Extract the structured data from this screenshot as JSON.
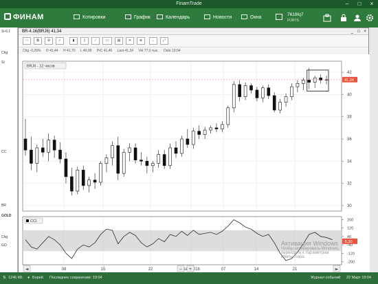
{
  "app": {
    "window_title": "FinamTrade",
    "logo": "ФИНАМ"
  },
  "menu": [
    {
      "label": "Котировки",
      "icon": "quotes-icon"
    },
    {
      "label": "График",
      "icon": "chart-icon"
    },
    {
      "label": "Календарь",
      "icon": "calendar-icon"
    },
    {
      "label": "Новости",
      "icon": "news-icon"
    },
    {
      "label": "Окна",
      "icon": "windows-icon"
    }
  ],
  "account": {
    "id": "7618fq7",
    "market": "FORTS"
  },
  "side_stubs": [
    "Si-6.1",
    "Chg",
    "SI",
    "CC",
    "BR",
    "GOLD",
    "Chg",
    "GO"
  ],
  "chart_window": {
    "title": "BR-4.16(BRJ6) 41,34",
    "info": {
      "chg": "Chg -0,29%",
      "open": "O 41,44",
      "high": "H 41,70",
      "low": "L 40,99",
      "prev": "PrC 41,46",
      "last": "Last 41,34",
      "vol": "Vol 77,0 тыс.",
      "date": "Date 19:04"
    },
    "series_label": "BRJ6 - 12 часов",
    "indicator_label": "CCI",
    "price_tag": "41,34",
    "cci_tag": "-5,30"
  },
  "chart_data": {
    "type": "candlestick",
    "series_name": "BRJ6 - 12 часов",
    "y_ticks": [
      30,
      32,
      34,
      36,
      38,
      40,
      42
    ],
    "y_range": [
      29.5,
      43
    ],
    "x_labels": [
      "08",
      "15",
      "22",
      "мар 2016",
      "07",
      "14",
      "21"
    ],
    "cci_ticks": [
      200,
      120,
      40,
      -40,
      -120,
      -200
    ],
    "cci_range": [
      -230,
      230
    ],
    "cci_band": [
      -100,
      100
    ],
    "candles": [
      {
        "o": 36.0,
        "h": 37.8,
        "l": 34.5,
        "c": 35.0
      },
      {
        "o": 35.0,
        "h": 36.2,
        "l": 33.2,
        "c": 33.8
      },
      {
        "o": 33.8,
        "h": 35.5,
        "l": 33.0,
        "c": 35.2
      },
      {
        "o": 35.2,
        "h": 36.0,
        "l": 34.4,
        "c": 34.8
      },
      {
        "o": 34.8,
        "h": 36.5,
        "l": 34.0,
        "c": 35.9
      },
      {
        "o": 35.9,
        "h": 36.3,
        "l": 34.3,
        "c": 35.0
      },
      {
        "o": 35.0,
        "h": 35.7,
        "l": 33.8,
        "c": 34.2
      },
      {
        "o": 34.2,
        "h": 34.8,
        "l": 32.0,
        "c": 32.6
      },
      {
        "o": 32.6,
        "h": 33.4,
        "l": 30.9,
        "c": 31.3
      },
      {
        "o": 31.3,
        "h": 33.5,
        "l": 31.0,
        "c": 33.2
      },
      {
        "o": 33.2,
        "h": 33.6,
        "l": 31.4,
        "c": 31.8
      },
      {
        "o": 31.8,
        "h": 32.6,
        "l": 31.2,
        "c": 32.3
      },
      {
        "o": 32.3,
        "h": 32.9,
        "l": 31.5,
        "c": 32.1
      },
      {
        "o": 32.1,
        "h": 34.0,
        "l": 31.8,
        "c": 33.8
      },
      {
        "o": 33.8,
        "h": 34.6,
        "l": 33.0,
        "c": 34.3
      },
      {
        "o": 34.3,
        "h": 35.8,
        "l": 33.6,
        "c": 35.4
      },
      {
        "o": 35.4,
        "h": 36.2,
        "l": 32.3,
        "c": 32.9
      },
      {
        "o": 32.9,
        "h": 35.1,
        "l": 32.6,
        "c": 34.8
      },
      {
        "o": 34.8,
        "h": 35.6,
        "l": 34.0,
        "c": 35.2
      },
      {
        "o": 35.2,
        "h": 35.6,
        "l": 33.8,
        "c": 34.1
      },
      {
        "o": 34.1,
        "h": 34.8,
        "l": 33.6,
        "c": 34.0
      },
      {
        "o": 34.0,
        "h": 34.4,
        "l": 32.9,
        "c": 33.6
      },
      {
        "o": 33.6,
        "h": 34.0,
        "l": 33.0,
        "c": 33.8
      },
      {
        "o": 33.8,
        "h": 35.0,
        "l": 33.4,
        "c": 34.6
      },
      {
        "o": 34.6,
        "h": 35.0,
        "l": 33.3,
        "c": 33.6
      },
      {
        "o": 33.6,
        "h": 35.6,
        "l": 33.3,
        "c": 35.2
      },
      {
        "o": 35.2,
        "h": 35.8,
        "l": 34.3,
        "c": 34.7
      },
      {
        "o": 34.7,
        "h": 36.3,
        "l": 34.4,
        "c": 36.0
      },
      {
        "o": 36.0,
        "h": 36.9,
        "l": 35.2,
        "c": 35.5
      },
      {
        "o": 35.5,
        "h": 37.0,
        "l": 35.1,
        "c": 36.7
      },
      {
        "o": 36.7,
        "h": 37.2,
        "l": 36.0,
        "c": 36.4
      },
      {
        "o": 36.4,
        "h": 37.1,
        "l": 36.0,
        "c": 36.8
      },
      {
        "o": 36.8,
        "h": 37.2,
        "l": 36.5,
        "c": 37.0
      },
      {
        "o": 37.0,
        "h": 37.4,
        "l": 36.6,
        "c": 36.9
      },
      {
        "o": 36.9,
        "h": 37.6,
        "l": 36.6,
        "c": 37.3
      },
      {
        "o": 37.3,
        "h": 39.0,
        "l": 37.0,
        "c": 38.8
      },
      {
        "o": 38.8,
        "h": 41.2,
        "l": 38.4,
        "c": 40.9
      },
      {
        "o": 40.9,
        "h": 41.3,
        "l": 39.4,
        "c": 39.8
      },
      {
        "o": 39.8,
        "h": 41.1,
        "l": 39.5,
        "c": 40.8
      },
      {
        "o": 40.8,
        "h": 41.0,
        "l": 40.1,
        "c": 40.4
      },
      {
        "o": 40.4,
        "h": 40.7,
        "l": 39.4,
        "c": 39.7
      },
      {
        "o": 39.7,
        "h": 40.8,
        "l": 39.3,
        "c": 40.6
      },
      {
        "o": 40.6,
        "h": 40.9,
        "l": 39.6,
        "c": 39.9
      },
      {
        "o": 39.9,
        "h": 40.2,
        "l": 38.4,
        "c": 38.6
      },
      {
        "o": 38.6,
        "h": 39.6,
        "l": 38.3,
        "c": 39.3
      },
      {
        "o": 39.3,
        "h": 40.1,
        "l": 38.9,
        "c": 39.8
      },
      {
        "o": 39.8,
        "h": 41.0,
        "l": 39.5,
        "c": 40.7
      },
      {
        "o": 40.7,
        "h": 41.3,
        "l": 40.2,
        "c": 41.0
      },
      {
        "o": 41.0,
        "h": 41.5,
        "l": 40.4,
        "c": 41.3
      },
      {
        "o": 41.3,
        "h": 42.4,
        "l": 40.5,
        "c": 41.1
      },
      {
        "o": 41.1,
        "h": 41.7,
        "l": 40.6,
        "c": 41.5
      },
      {
        "o": 41.5,
        "h": 41.8,
        "l": 41.0,
        "c": 41.3
      },
      {
        "o": 41.3,
        "h": 41.7,
        "l": 40.9,
        "c": 41.34
      }
    ],
    "cci": [
      10,
      -60,
      -80,
      -20,
      40,
      10,
      -40,
      -120,
      -170,
      -80,
      -40,
      -60,
      -20,
      60,
      110,
      100,
      -30,
      40,
      80,
      50,
      -20,
      -60,
      -30,
      20,
      -10,
      60,
      40,
      90,
      50,
      100,
      60,
      70,
      80,
      60,
      90,
      140,
      200,
      170,
      130,
      110,
      70,
      40,
      60,
      -20,
      -120,
      -190,
      -170,
      -110,
      -30,
      60,
      80,
      40,
      30,
      10
    ]
  },
  "chart_footer": {
    "zoom_minus": "−",
    "zoom_plus": "+",
    "scroll_left": "◄",
    "scroll_right": "►"
  },
  "watermark": {
    "title": "Активация Windows",
    "line1": "Чтобы активировать Windows,",
    "line2": "перейдите к параметрам",
    "line3": "компьютера."
  },
  "status": {
    "traffic": "1246 КБ",
    "server": "Борей",
    "autosave": "Последнее сохранение: 19:04",
    "journal": "Журнал событий",
    "datetime": "22 Март 19:04"
  },
  "colors": {
    "brand_green": "#2f7a3d",
    "dark_green": "#1c5a2b",
    "price_tag": "#e8553f",
    "cci_tag": "#e8553f",
    "band": "#cfcfcf"
  }
}
